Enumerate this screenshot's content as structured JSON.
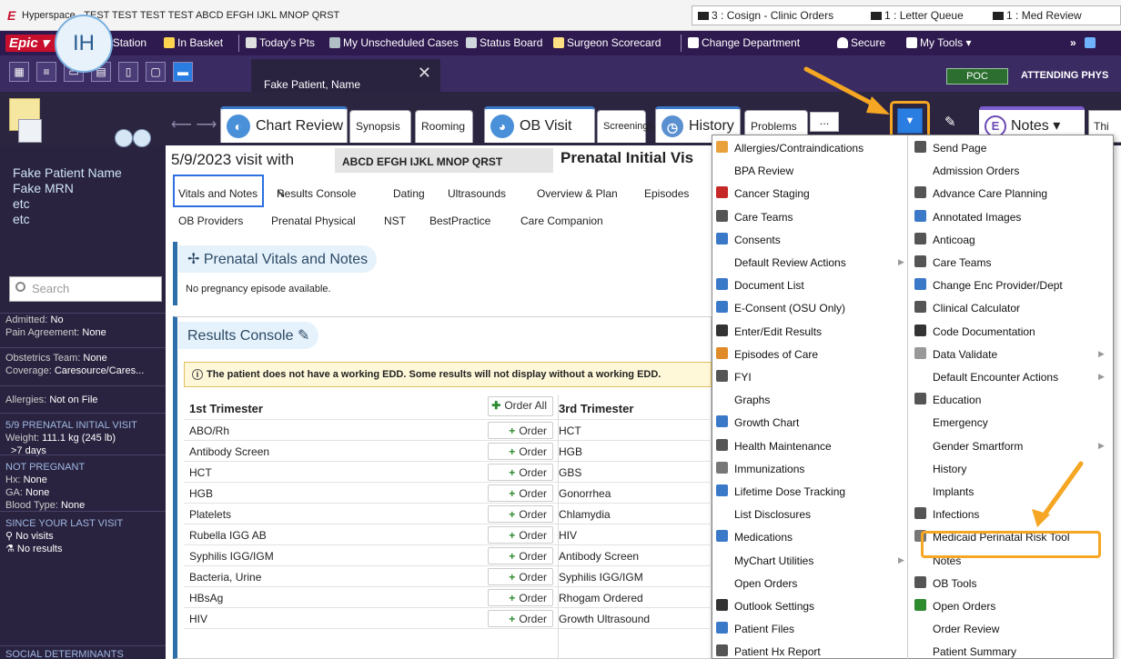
{
  "titlebar": {
    "app_name": "Hyperspace -",
    "title": "TEST TEST TEST TEST ABCD EFGH IJKL MNOP QRST",
    "inbox": [
      {
        "count": "3",
        "label": "Cosign - Clinic Orders"
      },
      {
        "count": "1",
        "label": "Letter Queue"
      },
      {
        "count": "1",
        "label": "Med Review"
      }
    ]
  },
  "epic_toolbar": {
    "logo": "Epic",
    "items": [
      "Patient Station",
      "In Basket",
      "Today's Pts",
      "My Unscheduled Cases",
      "Status Board",
      "Surgeon Scorecard",
      "Change Department",
      "Secure",
      "My Tools"
    ]
  },
  "patient_tab": {
    "label": "Fake Patient, Name"
  },
  "status": {
    "poc": "POC",
    "attending": "ATTENDING PHYS"
  },
  "avatar": {
    "initials": "IH"
  },
  "activity_tabs": {
    "chart_review": "Chart Review",
    "synopsis": "Synopsis",
    "rooming": "Rooming",
    "ob_visit": "OB Visit",
    "screenings": "Screenings",
    "history": "History",
    "problems": "Problems",
    "more": "...",
    "notes": "Notes",
    "thi": "Thi"
  },
  "sidebar": {
    "name_lines": [
      "Fake Patient Name",
      "Fake MRN",
      "etc",
      "etc"
    ],
    "search_placeholder": "Search",
    "admitted_label": "Admitted:",
    "admitted_value": "No",
    "pain_label": "Pain Agreement:",
    "pain_value": "None",
    "ob_team_label": "Obstetrics Team:",
    "ob_team_value": "None",
    "coverage_label": "Coverage:",
    "coverage_value": "Caresource/Cares...",
    "allergies_label": "Allergies:",
    "allergies_value": "Not on File",
    "visit_header": "5/9 PRENATAL INITIAL VISIT",
    "weight_label": "Weight:",
    "weight_value": "111.1 kg (245 lb)",
    "weight_note": ">7 days",
    "preg_header": "NOT PREGNANT",
    "hx_label": "Hx:",
    "hx_value": "None",
    "ga_label": "GA:",
    "ga_value": "None",
    "blood_label": "Blood Type:",
    "blood_value": "None",
    "since_header": "SINCE YOUR LAST VISIT",
    "no_visits": "No visits",
    "no_results": "No results",
    "social_header": "SOCIAL DETERMINANTS"
  },
  "main": {
    "visit_prefix": "5/9/2023 visit with",
    "visit_provider": "ABCD EFGH IJKL MNOP QRST",
    "visit_type": "Prenatal Initial Vis",
    "nav_row1": [
      "Vitals and Notes",
      "Results Console",
      "Dating",
      "Ultrasounds",
      "Overview & Plan",
      "Episodes"
    ],
    "nav_row2": [
      "OB Providers",
      "Prenatal Physical",
      "NST",
      "BestPractice",
      "Care Companion"
    ],
    "vitals_header": "Prenatal Vitals and Notes",
    "vitals_msg": "No pregnancy episode available.",
    "results_header": "Results Console",
    "warning": "The patient does not have a working EDD. Some results will not display without a working EDD.",
    "col1_header": "1st Trimester",
    "order_all": "Order All",
    "col3_header": "3rd Trimester",
    "order_label": "Order",
    "rows": [
      {
        "left": "ABO/Rh",
        "right": "HCT"
      },
      {
        "left": "Antibody Screen",
        "right": "HGB"
      },
      {
        "left": "HCT",
        "right": "GBS"
      },
      {
        "left": "HGB",
        "right": "Gonorrhea"
      },
      {
        "left": "Platelets",
        "right": "Chlamydia"
      },
      {
        "left": "Rubella IGG AB",
        "right": "HIV"
      },
      {
        "left": "Syphilis IGG/IGM",
        "right": "Antibody Screen"
      },
      {
        "left": "Bacteria, Urine",
        "right": "Syphilis IGG/IGM"
      },
      {
        "left": "HBsAg",
        "right": "Rhogam Ordered"
      },
      {
        "left": "HIV",
        "right": "Growth Ultrasound"
      }
    ]
  },
  "menu": {
    "left": [
      "Allergies/Contraindications",
      "BPA Review",
      "Cancer Staging",
      "Care Teams",
      "Consents",
      "Default Review Actions",
      "Document List",
      "E-Consent (OSU Only)",
      "Enter/Edit Results",
      "Episodes of Care",
      "FYI",
      "Graphs",
      "Growth Chart",
      "Health Maintenance",
      "Immunizations",
      "Lifetime Dose Tracking",
      "List Disclosures",
      "Medications",
      "MyChart Utilities",
      "Open Orders",
      "Outlook Settings",
      "Patient Files",
      "Patient Hx Report"
    ],
    "right": [
      "Send Page",
      "Admission Orders",
      "Advance Care Planning",
      "Annotated Images",
      "Anticoag",
      "Care Teams",
      "Change Enc Provider/Dept",
      "Clinical Calculator",
      "Code Documentation",
      "Data Validate",
      "Default Encounter Actions",
      "Education",
      "Emergency",
      "Gender Smartform",
      "History",
      "Implants",
      "Infections",
      "Medicaid Perinatal Risk Tool",
      "Notes",
      "OB Tools",
      "Open Orders",
      "Order Review",
      "Patient Summary"
    ]
  },
  "colors": {
    "epic_purple": "#2e1a4f",
    "accent_blue": "#2a7de1",
    "highlight_orange": "#f5a623"
  }
}
